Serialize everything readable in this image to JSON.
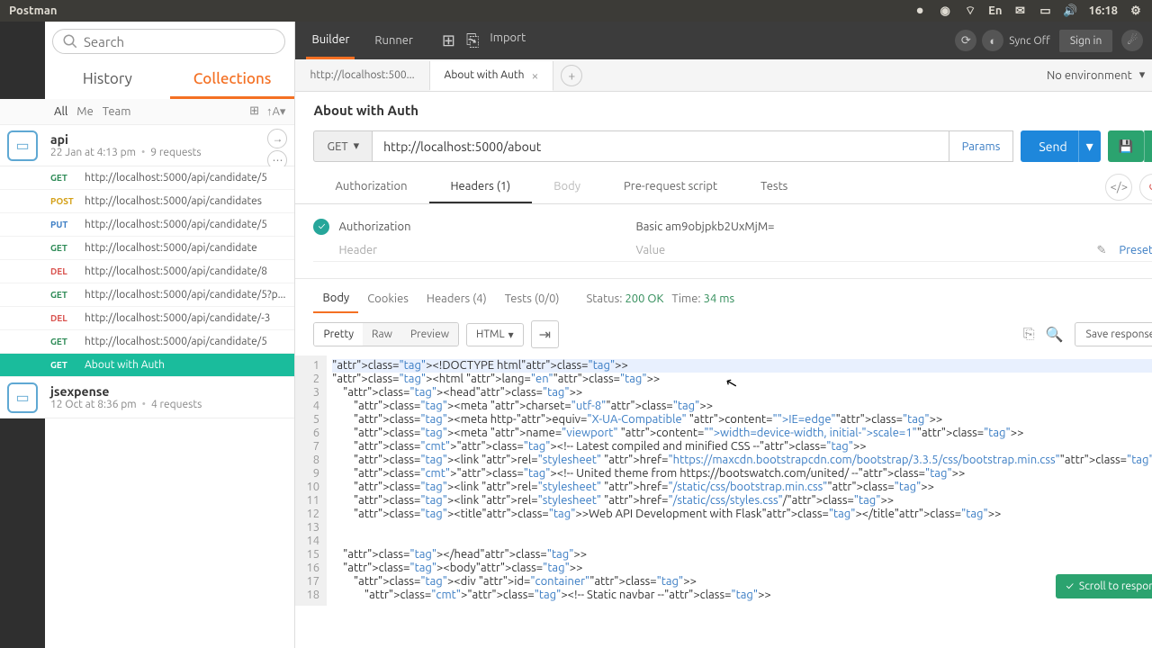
{
  "titlebar": {
    "app": "Postman",
    "time": "16:18",
    "lang": "En"
  },
  "search": {
    "placeholder": "Search"
  },
  "sidebar_tabs": {
    "history": "History",
    "collections": "Collections"
  },
  "filter": {
    "all": "All",
    "me": "Me",
    "team": "Team"
  },
  "collections": [
    {
      "name": "api",
      "date": "22 Jan at 4:13 pm",
      "count": "9 requests",
      "requests": [
        {
          "method": "GET",
          "url": "http://localhost:5000/api/candidate/5"
        },
        {
          "method": "POST",
          "url": "http://localhost:5000/api/candidates"
        },
        {
          "method": "PUT",
          "url": "http://localhost:5000/api/candidate/5"
        },
        {
          "method": "GET",
          "url": "http://localhost:5000/api/candidate"
        },
        {
          "method": "DEL",
          "url": "http://localhost:5000/api/candidate/8"
        },
        {
          "method": "GET",
          "url": "http://localhost:5000/api/candidate/5?p..."
        },
        {
          "method": "DEL",
          "url": "http://localhost:5000/api/candidate/-3"
        },
        {
          "method": "GET",
          "url": "http://localhost:5000/api/candidate/5"
        },
        {
          "method": "GET",
          "url": "About with Auth",
          "active": true
        }
      ]
    },
    {
      "name": "jsexpense",
      "date": "12 Oct at 8:36 pm",
      "count": "4 requests"
    }
  ],
  "topbar": {
    "builder": "Builder",
    "runner": "Runner",
    "import": "Import",
    "sync": "Sync Off",
    "signin": "Sign in"
  },
  "tabs": [
    {
      "label": "http://localhost:500..."
    },
    {
      "label": "About with Auth",
      "active": true
    }
  ],
  "env": "No environment",
  "request": {
    "name": "About with Auth",
    "method": "GET",
    "url": "http://localhost:5000/about",
    "params": "Params",
    "send": "Send"
  },
  "cfg_tabs": {
    "auth": "Authorization",
    "headers": "Headers (1)",
    "body": "Body",
    "pre": "Pre-request script",
    "tests": "Tests"
  },
  "headers": {
    "row": {
      "key": "Authorization",
      "value": "Basic am9objpkb2UxMjM="
    },
    "placeholder_key": "Header",
    "placeholder_val": "Value",
    "presets": "Presets"
  },
  "resp_tabs": {
    "body": "Body",
    "cookies": "Cookies",
    "headers": "Headers (4)",
    "tests": "Tests (0/0)"
  },
  "status": {
    "status_label": "Status:",
    "code": "200 OK",
    "time_label": "Time:",
    "time": "34 ms"
  },
  "view": {
    "pretty": "Pretty",
    "raw": "Raw",
    "preview": "Preview",
    "format": "HTML",
    "save": "Save response"
  },
  "scroll": "Scroll to respons",
  "code_lines": [
    "<!DOCTYPE html>",
    "<html lang=\"en\">",
    "    <head>",
    "        <meta charset=\"utf-8\">",
    "        <meta http-equiv=\"X-UA-Compatible\" content=\"IE=edge\">",
    "        <meta name=\"viewport\" content=\"width=device-width, initial-scale=1\">",
    "        <!-- Latest compiled and minified CSS -->",
    "        <link rel=\"stylesheet\" href=\"https://maxcdn.bootstrapcdn.com/bootstrap/3.3.5/css/bootstrap.min.css\">",
    "        <!-- United theme from https://bootswatch.com/united/ -->",
    "        <link rel=\"stylesheet\" href=\"/static/css/bootstrap.min.css\">",
    "        <link rel=\"stylesheet\" href=\"/static/css/styles.css\"/>",
    "        <title>Web API Development with Flask</title>",
    "",
    "",
    "    </head>",
    "    <body>",
    "        <div id=\"container\">",
    "            <!-- Static navbar -->"
  ]
}
